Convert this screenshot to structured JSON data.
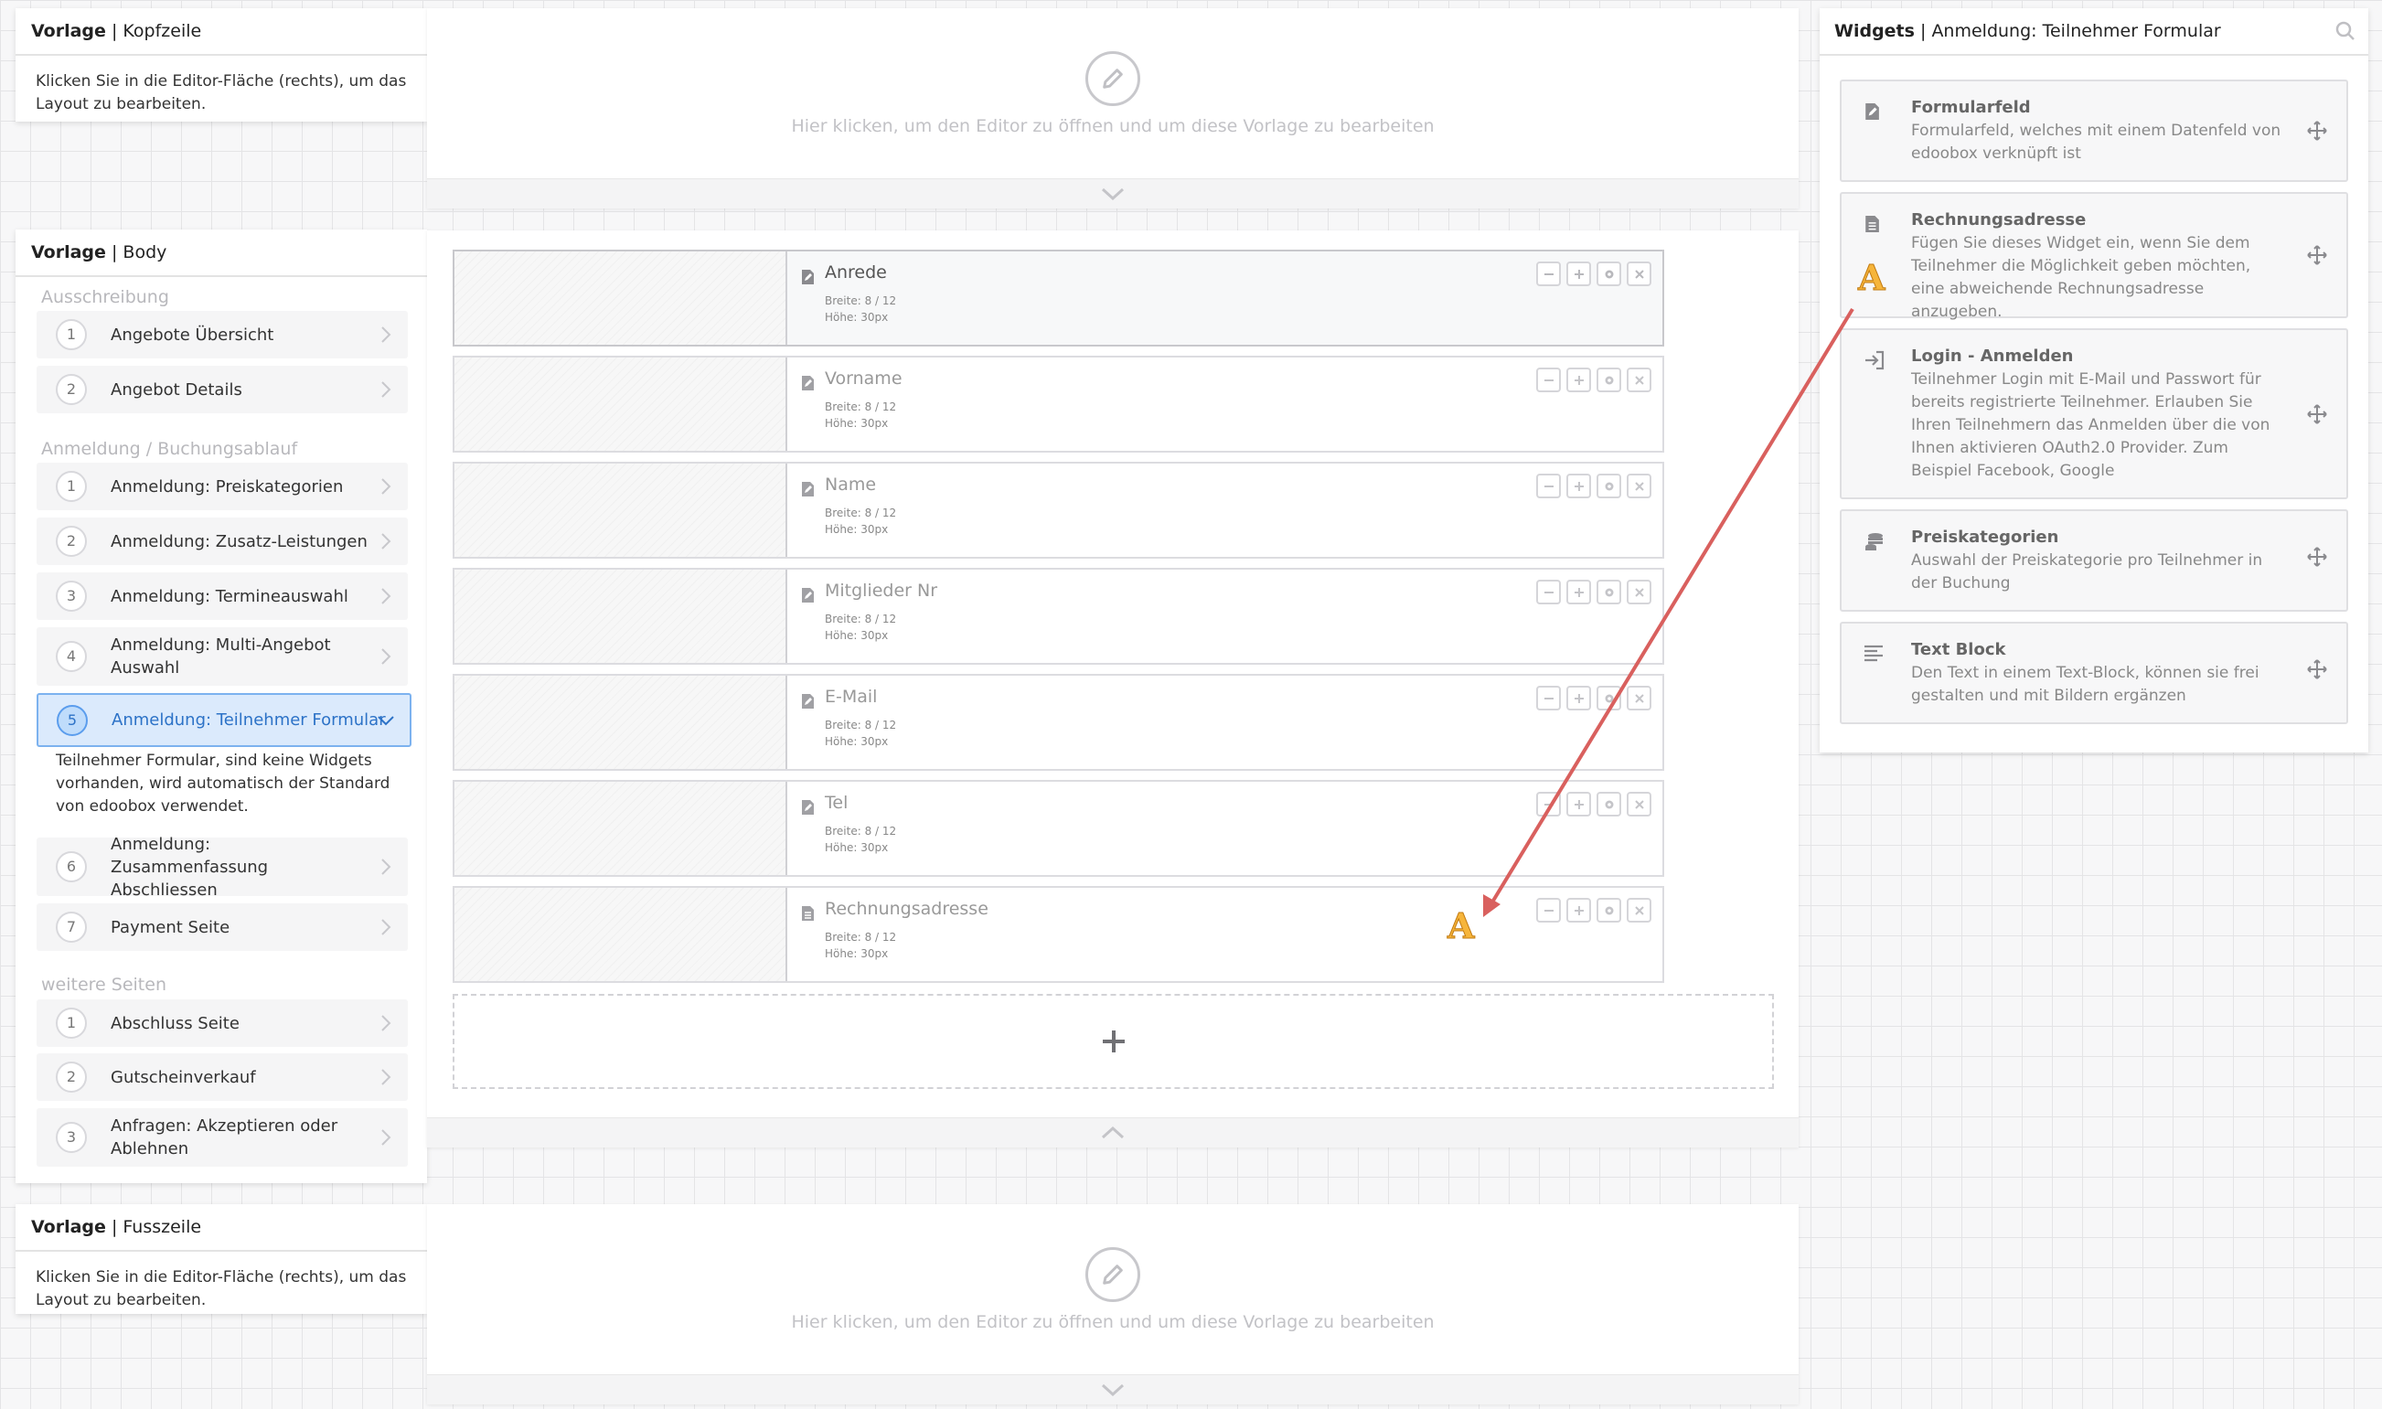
{
  "header_template": {
    "title_strong": "Vorlage",
    "title_rest": "Kopfzeile",
    "description": "Klicken Sie in die Editor-Fläche (rechts), um das Layout zu bearbeiten.",
    "editor_hint": "Hier klicken, um den Editor zu öffnen und um diese Vorlage zu bearbeiten"
  },
  "body_template": {
    "title_strong": "Vorlage",
    "title_rest": "Body",
    "groups": [
      {
        "label": "Ausschreibung",
        "items": [
          {
            "num": "1",
            "label": "Angebote Übersicht"
          },
          {
            "num": "2",
            "label": "Angebot Details"
          }
        ]
      },
      {
        "label": "Anmeldung / Buchungsablauf",
        "items": [
          {
            "num": "1",
            "label": "Anmeldung: Preiskategorien"
          },
          {
            "num": "2",
            "label": "Anmeldung: Zusatz-Leistungen"
          },
          {
            "num": "3",
            "label": "Anmeldung: Termineauswahl"
          },
          {
            "num": "4",
            "label": "Anmeldung: Multi-Angebot Auswahl"
          },
          {
            "num": "5",
            "label": "Anmeldung: Teilnehmer Formular",
            "description": "Teilnehmer Formular, sind keine Widgets vorhanden, wird automatisch der Standard von edoobox verwendet."
          },
          {
            "num": "6",
            "label": "Anmeldung: Zusammenfassung Abschliessen"
          },
          {
            "num": "7",
            "label": "Payment Seite"
          }
        ]
      },
      {
        "label": "weitere Seiten",
        "items": [
          {
            "num": "1",
            "label": "Abschluss Seite"
          },
          {
            "num": "2",
            "label": "Gutscheinverkauf"
          },
          {
            "num": "3",
            "label": "Anfragen: Akzeptieren oder Ablehnen"
          }
        ]
      }
    ]
  },
  "footer_template": {
    "title_strong": "Vorlage",
    "title_rest": "Fusszeile",
    "description": "Klicken Sie in die Editor-Fläche (rechts), um das Layout zu bearbeiten.",
    "editor_hint": "Hier klicken, um den Editor zu öffnen und um diese Vorlage zu bearbeiten"
  },
  "form_rows": [
    {
      "title": "Anrede",
      "width": "Breite: 8 / 12",
      "height": "Höhe: 30px",
      "icon": "form-field-icon"
    },
    {
      "title": "Vorname",
      "width": "Breite: 8 / 12",
      "height": "Höhe: 30px",
      "icon": "form-field-icon"
    },
    {
      "title": "Name",
      "width": "Breite: 8 / 12",
      "height": "Höhe: 30px",
      "icon": "form-field-icon"
    },
    {
      "title": "Mitglieder Nr",
      "width": "Breite: 8 / 12",
      "height": "Höhe: 30px",
      "icon": "form-field-icon"
    },
    {
      "title": "E-Mail",
      "width": "Breite: 8 / 12",
      "height": "Höhe: 30px",
      "icon": "form-field-icon"
    },
    {
      "title": "Tel",
      "width": "Breite: 8 / 12",
      "height": "Höhe: 30px",
      "icon": "form-field-icon"
    },
    {
      "title": "Rechnungsadresse",
      "width": "Breite: 8 / 12",
      "height": "Höhe: 30px",
      "icon": "document-icon"
    }
  ],
  "widgets_panel": {
    "title_strong": "Widgets",
    "title_rest": "Anmeldung: Teilnehmer Formular",
    "items": [
      {
        "title": "Formularfeld",
        "description": "Formularfeld, welches mit einem Datenfeld von edoobox verknüpft ist",
        "icon": "form-field-icon"
      },
      {
        "title": "Rechnungsadresse",
        "description": "Fügen Sie dieses Widget ein, wenn Sie dem Teilnehmer die Möglichkeit geben möchten, eine abweichende Rechnungsadresse anzugeben.",
        "icon": "document-icon"
      },
      {
        "title": "Login - Anmelden",
        "description": "Teilnehmer Login mit E-Mail und Passwort für bereits registrierte Teilnehmer. Erlauben Sie Ihren Teilnehmern das Anmelden über die von Ihnen aktivieren OAuth2.0 Provider. Zum Beispiel Facebook, Google",
        "icon": "login-icon"
      },
      {
        "title": "Preiskategorien",
        "description": "Auswahl der Preiskategorie pro Teilnehmer in der Buchung",
        "icon": "coins-icon"
      },
      {
        "title": "Text Block",
        "description": "Den Text in einem Text-Block, können sie frei gestalten und mit Bildern ergänzen",
        "icon": "text-block-icon"
      }
    ]
  },
  "annotation": {
    "marker_label": "A",
    "arrow_color": "#d9605e",
    "marker_color": "#f6b53b"
  },
  "colors": {
    "active_bg": "#dbeafc",
    "active_text": "#2c72c7"
  }
}
